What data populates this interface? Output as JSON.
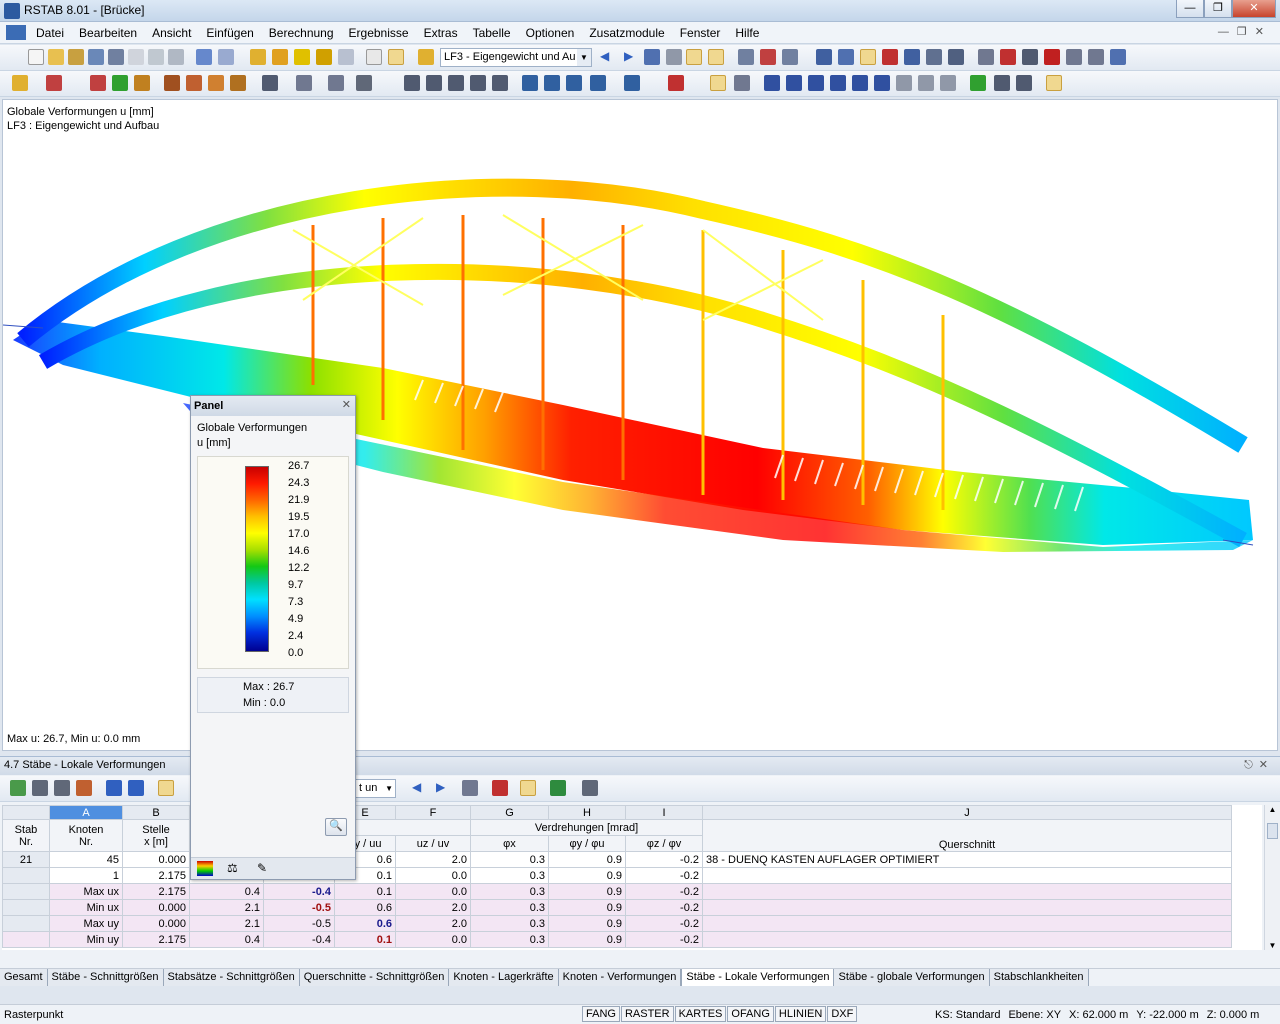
{
  "window": {
    "title": "RSTAB 8.01 - [Brücke]"
  },
  "menu": [
    "Datei",
    "Bearbeiten",
    "Ansicht",
    "Einfügen",
    "Berechnung",
    "Ergebnisse",
    "Extras",
    "Tabelle",
    "Optionen",
    "Zusatzmodule",
    "Fenster",
    "Hilfe"
  ],
  "toolbar": {
    "loadcase": "LF3 - Eigengewicht und Au"
  },
  "viewport": {
    "line1": "Globale Verformungen u [mm]",
    "line2": "LF3 : Eigengewicht und Aufbau",
    "footer": "Max u: 26.7, Min u: 0.0 mm"
  },
  "panel": {
    "title": "Panel",
    "heading1": "Globale Verformungen",
    "heading2": "u [mm]",
    "legend": [
      "26.7",
      "24.3",
      "21.9",
      "19.5",
      "17.0",
      "14.6",
      "12.2",
      "9.7",
      "7.3",
      "4.9",
      "2.4",
      "0.0"
    ],
    "max_label": "Max  :",
    "max_value": "26.7",
    "min_label": "Min   :",
    "min_value": "0.0"
  },
  "table": {
    "title": "4.7 Stäbe - Lokale Verformungen",
    "selector": "t un",
    "col_letters": [
      "A",
      "B",
      "E",
      "F",
      "G",
      "H",
      "I",
      "J"
    ],
    "hdr": {
      "stab": "Stab",
      "nr": "Nr.",
      "knoten": "Knoten",
      "knoten_nr": "Nr.",
      "stelle": "Stelle",
      "x": "x [m]",
      "verf": "en [mm]",
      "uy": "uy / uu",
      "uz": "uz / uv",
      "verdr": "Verdrehungen [mrad]",
      "phix": "φx",
      "phiy": "φy / φu",
      "phiz": "φz / φv",
      "qs": "Querschnitt"
    },
    "rows": [
      {
        "stab": "21",
        "knoten": "45",
        "x": "0.000",
        "c": "",
        "d": "",
        "e": "0.6",
        "f": "2.0",
        "g": "0.3",
        "h": "0.9",
        "i": "-0.2",
        "j": "38 - DUENQ KASTEN AUFLAGER OPTIMIERT"
      },
      {
        "stab": "",
        "knoten": "1",
        "x": "2.175",
        "c": "",
        "d": "",
        "e": "0.1",
        "f": "0.0",
        "g": "0.3",
        "h": "0.9",
        "i": "-0.2",
        "j": ""
      },
      {
        "stab": "",
        "knoten": "Max ux",
        "x": "2.175",
        "c": "0.4",
        "d": "-0.4",
        "e": "0.1",
        "f": "0.0",
        "g": "0.3",
        "h": "0.9",
        "i": "-0.2",
        "j": ""
      },
      {
        "stab": "",
        "knoten": "Min ux",
        "x": "0.000",
        "c": "2.1",
        "d": "-0.5",
        "e": "0.6",
        "f": "2.0",
        "g": "0.3",
        "h": "0.9",
        "i": "-0.2",
        "j": ""
      },
      {
        "stab": "",
        "knoten": "Max uy",
        "x": "0.000",
        "c": "2.1",
        "d": "-0.5",
        "e": "0.6",
        "f": "2.0",
        "g": "0.3",
        "h": "0.9",
        "i": "-0.2",
        "j": ""
      },
      {
        "stab": "",
        "knoten": "Min uy",
        "x": "2.175",
        "c": "0.4",
        "d": "-0.4",
        "e": "0.1",
        "f": "0.0",
        "g": "0.3",
        "h": "0.9",
        "i": "-0.2",
        "j": ""
      }
    ]
  },
  "tabs": [
    "Gesamt",
    "Stäbe - Schnittgrößen",
    "Stabsätze - Schnittgrößen",
    "Querschnitte - Schnittgrößen",
    "Knoten - Lagerkräfte",
    "Knoten - Verformungen",
    "Stäbe - Lokale Verformungen",
    "Stäbe - globale Verformungen",
    "Stabschlankheiten"
  ],
  "active_tab": 6,
  "status": {
    "left": "Rasterpunkt",
    "buttons": [
      "FANG",
      "RASTER",
      "KARTES",
      "OFANG",
      "HLINIEN",
      "DXF"
    ],
    "ks": "KS: Standard",
    "ebene": "Ebene: XY",
    "x": "X:  62.000 m",
    "y": "Y:  -22.000 m",
    "z": "Z:   0.000 m"
  }
}
